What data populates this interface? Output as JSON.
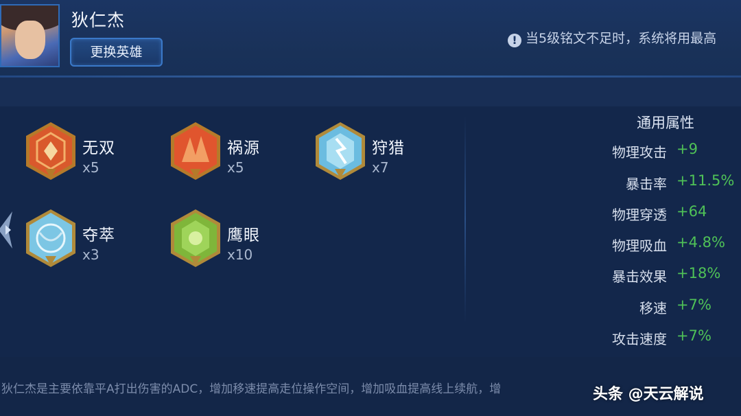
{
  "hero": {
    "name": "狄仁杰",
    "change_button": "更换英雄"
  },
  "notice": {
    "icon": "info-icon",
    "text": "当5级铭文不足时，系统将用最高"
  },
  "runes": [
    {
      "name": "无双",
      "count": "x5",
      "color": "#d9592c"
    },
    {
      "name": "祸源",
      "count": "x5",
      "color": "#d9592c"
    },
    {
      "name": "狩猎",
      "count": "x7",
      "color": "#6bbce0"
    },
    {
      "name": "夺萃",
      "count": "x3",
      "color": "#6bbce0"
    },
    {
      "name": "鹰眼",
      "count": "x10",
      "color": "#7fb63a"
    }
  ],
  "attributes": {
    "title": "通用属性",
    "rows": [
      {
        "name": "物理攻击",
        "value": "+9"
      },
      {
        "name": "暴击率",
        "value": "+11.5%"
      },
      {
        "name": "物理穿透",
        "value": "+64"
      },
      {
        "name": "物理吸血",
        "value": "+4.8%"
      },
      {
        "name": "暴击效果",
        "value": "+18%"
      },
      {
        "name": "移速",
        "value": "+7%"
      },
      {
        "name": "攻击速度",
        "value": "+7%"
      }
    ]
  },
  "description": "狄仁杰是主要依靠平A打出伤害的ADC，增加移速提高走位操作空间，增加吸血提高线上续航，增",
  "watermark": "头条 @天云解说",
  "colors": {
    "value_green": "#4fc257",
    "accent_blue": "#3a79c9"
  }
}
